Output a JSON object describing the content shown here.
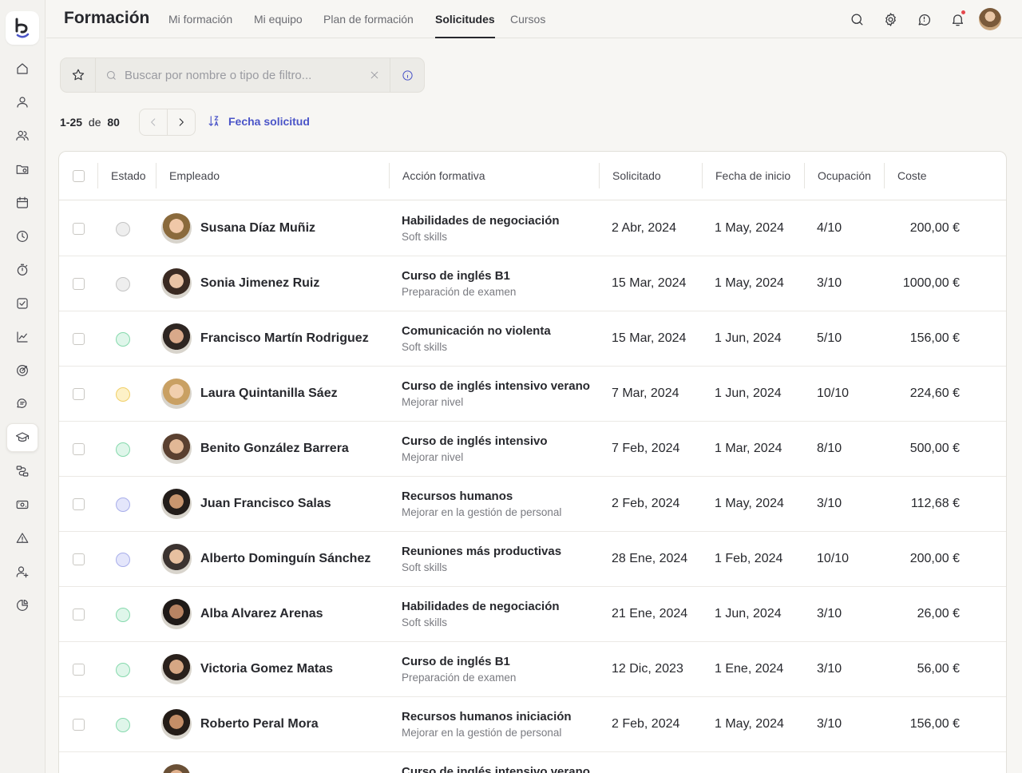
{
  "app": {
    "title": "Formación",
    "tabs": [
      {
        "label": "Mi formación"
      },
      {
        "label": "Mi equipo"
      },
      {
        "label": "Plan de formación"
      },
      {
        "label": "Solicitudes"
      },
      {
        "label": "Cursos"
      }
    ],
    "active_tab": "Solicitudes"
  },
  "header_icons": [
    "search-icon",
    "gear-icon",
    "chat-icon",
    "bell-icon"
  ],
  "sidebar": {
    "items": [
      "home-icon",
      "user-icon",
      "users-icon",
      "folder-icon",
      "calendar-icon",
      "clock-icon",
      "timer-icon",
      "checkbox-icon",
      "chart-icon",
      "target-icon",
      "messages-icon",
      "graduation-cap-icon",
      "workflow-icon",
      "money-icon",
      "alert-icon",
      "user-plus-icon",
      "pie-chart-icon"
    ],
    "active": "graduation-cap-icon"
  },
  "search": {
    "placeholder": "Buscar por nombre o tipo de filtro...",
    "value": ""
  },
  "pagination": {
    "range": "1-25",
    "of_label": "de",
    "total": "80"
  },
  "sort": {
    "label": "Fecha solicitud"
  },
  "table": {
    "columns": {
      "estado": "Estado",
      "empleado": "Empleado",
      "accion": "Acción formativa",
      "solicitado": "Solicitado",
      "inicio": "Fecha de inicio",
      "ocupacion": "Ocupación",
      "coste": "Coste"
    },
    "status_colors": {
      "gray": {
        "bg": "#eeeeee",
        "border": "#c4c4c4"
      },
      "green": {
        "bg": "#dff6ea",
        "border": "#86d9ad"
      },
      "yellow": {
        "bg": "#fdf1c7",
        "border": "#f0cf68"
      },
      "purple": {
        "bg": "#e4e6fb",
        "border": "#a8aeea"
      }
    },
    "rows": [
      {
        "status": "gray",
        "name": "Susana Díaz Muñiz",
        "course": "Habilidades de negociación",
        "category": "Soft skills",
        "requested": "2 Abr, 2024",
        "start": "1 May, 2024",
        "occupancy": "4/10",
        "cost": "200,00 €"
      },
      {
        "status": "gray",
        "name": "Sonia Jimenez Ruiz",
        "course": "Curso de inglés B1",
        "category": "Preparación de examen",
        "requested": "15 Mar, 2024",
        "start": "1 May, 2024",
        "occupancy": "3/10",
        "cost": "1000,00 €"
      },
      {
        "status": "green",
        "name": "Francisco Martín Rodriguez",
        "course": "Comunicación no violenta",
        "category": "Soft skills",
        "requested": "15 Mar, 2024",
        "start": "1 Jun, 2024",
        "occupancy": "5/10",
        "cost": "156,00 €"
      },
      {
        "status": "yellow",
        "name": "Laura Quintanilla Sáez",
        "course": "Curso de inglés intensivo verano",
        "category": "Mejorar nivel",
        "requested": "7 Mar, 2024",
        "start": "1 Jun, 2024",
        "occupancy": "10/10",
        "cost": "224,60 €"
      },
      {
        "status": "green",
        "name": "Benito González Barrera",
        "course": "Curso de inglés intensivo",
        "category": "Mejorar nivel",
        "requested": "7 Feb, 2024",
        "start": "1 Mar, 2024",
        "occupancy": "8/10",
        "cost": "500,00 €"
      },
      {
        "status": "purple",
        "name": "Juan Francisco Salas",
        "course": "Recursos humanos",
        "category": "Mejorar en la gestión de personal",
        "requested": "2 Feb, 2024",
        "start": "1 May, 2024",
        "occupancy": "3/10",
        "cost": "112,68 €"
      },
      {
        "status": "purple",
        "name": "Alberto Dominguín Sánchez",
        "course": "Reuniones más productivas",
        "category": "Soft skills",
        "requested": "28 Ene, 2024",
        "start": "1 Feb, 2024",
        "occupancy": "10/10",
        "cost": "200,00 €"
      },
      {
        "status": "green",
        "name": "Alba Alvarez Arenas",
        "course": "Habilidades de negociación",
        "category": "Soft skills",
        "requested": "21 Ene, 2024",
        "start": "1 Jun, 2024",
        "occupancy": "3/10",
        "cost": "26,00 €"
      },
      {
        "status": "green",
        "name": "Victoria Gomez Matas",
        "course": "Curso de inglés B1",
        "category": "Preparación de examen",
        "requested": "12 Dic, 2023",
        "start": "1 Ene, 2024",
        "occupancy": "3/10",
        "cost": "56,00 €"
      },
      {
        "status": "green",
        "name": "Roberto Peral Mora",
        "course": "Recursos humanos iniciación",
        "category": "Mejorar en la gestión de personal",
        "requested": "2 Feb, 2024",
        "start": "1 May, 2024",
        "occupancy": "3/10",
        "cost": "156,00 €"
      },
      {
        "status": "green",
        "name": "",
        "course": "Curso de inglés intensivo verano",
        "category": "",
        "requested": "",
        "start": "",
        "occupancy": "",
        "cost": ""
      }
    ]
  }
}
